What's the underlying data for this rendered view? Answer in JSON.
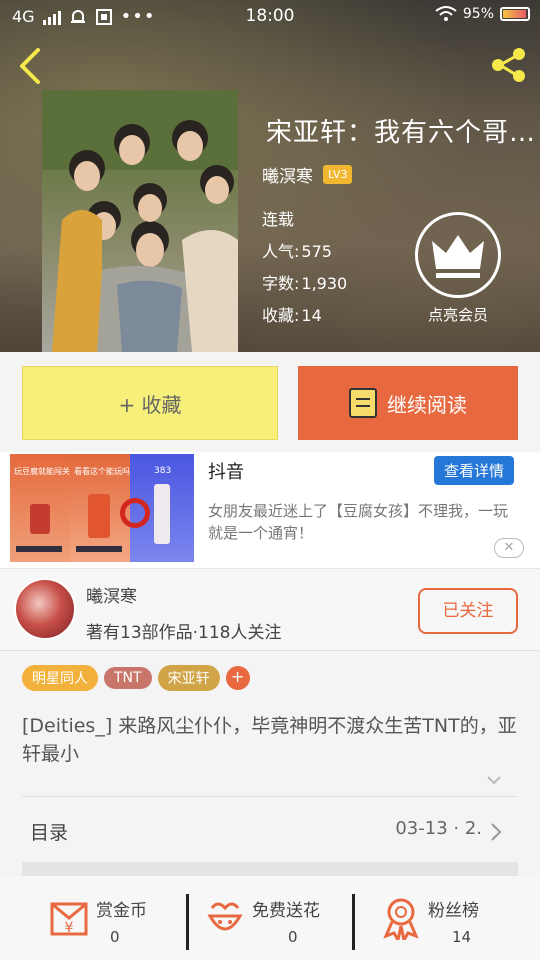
{
  "status_bar": {
    "network": "4G",
    "time": "18:00",
    "battery": "95%"
  },
  "book": {
    "title": "宋亚轩：我有六个哥…",
    "author": "曦溟寒",
    "author_level": "LV3",
    "status": "连载",
    "popularity_label": "人气:",
    "popularity": "575",
    "words_label": "字数:",
    "words": "1,930",
    "favorites_label": "收藏:",
    "favorites": "14",
    "vip_label": "点亮会员"
  },
  "actions": {
    "favorite": "+ 收藏",
    "continue_reading": "继续阅读"
  },
  "ad": {
    "title": "抖音",
    "details_button": "查看详情",
    "description": "女朋友最近迷上了【豆腐女孩】不理我，一玩就是一个通宵！",
    "close": "✕",
    "panel_texts": [
      "玩豆腐就能闯关",
      "看看这个能玩吗",
      "383"
    ]
  },
  "author_section": {
    "name": "曦溟寒",
    "stats": "著有13部作品·118人关注",
    "follow_button": "已关注"
  },
  "tags": [
    {
      "label": "明星同人",
      "color": "#f2b13a"
    },
    {
      "label": "TNT",
      "color": "#c9766a"
    },
    {
      "label": "宋亚轩",
      "color": "#d1a447"
    }
  ],
  "tag_add": "+",
  "description": "[Deities_] 来路风尘仆仆，毕竟神明不渡众生苦TNT的，亚轩最小",
  "toc": {
    "label": "目录",
    "value": "03-13 · 2."
  },
  "bottom_bar": [
    {
      "label": "赏金币",
      "value": "0",
      "icon": "money-envelope-icon"
    },
    {
      "label": "免费送花",
      "value": "0",
      "icon": "flower-icon"
    },
    {
      "label": "粉丝榜",
      "value": "14",
      "icon": "medal-icon"
    }
  ],
  "colors": {
    "accent_orange": "#e8693f",
    "favorite_yellow": "#f6f07a",
    "level_gold": "#f1b731",
    "ad_blue": "#2577d8"
  }
}
